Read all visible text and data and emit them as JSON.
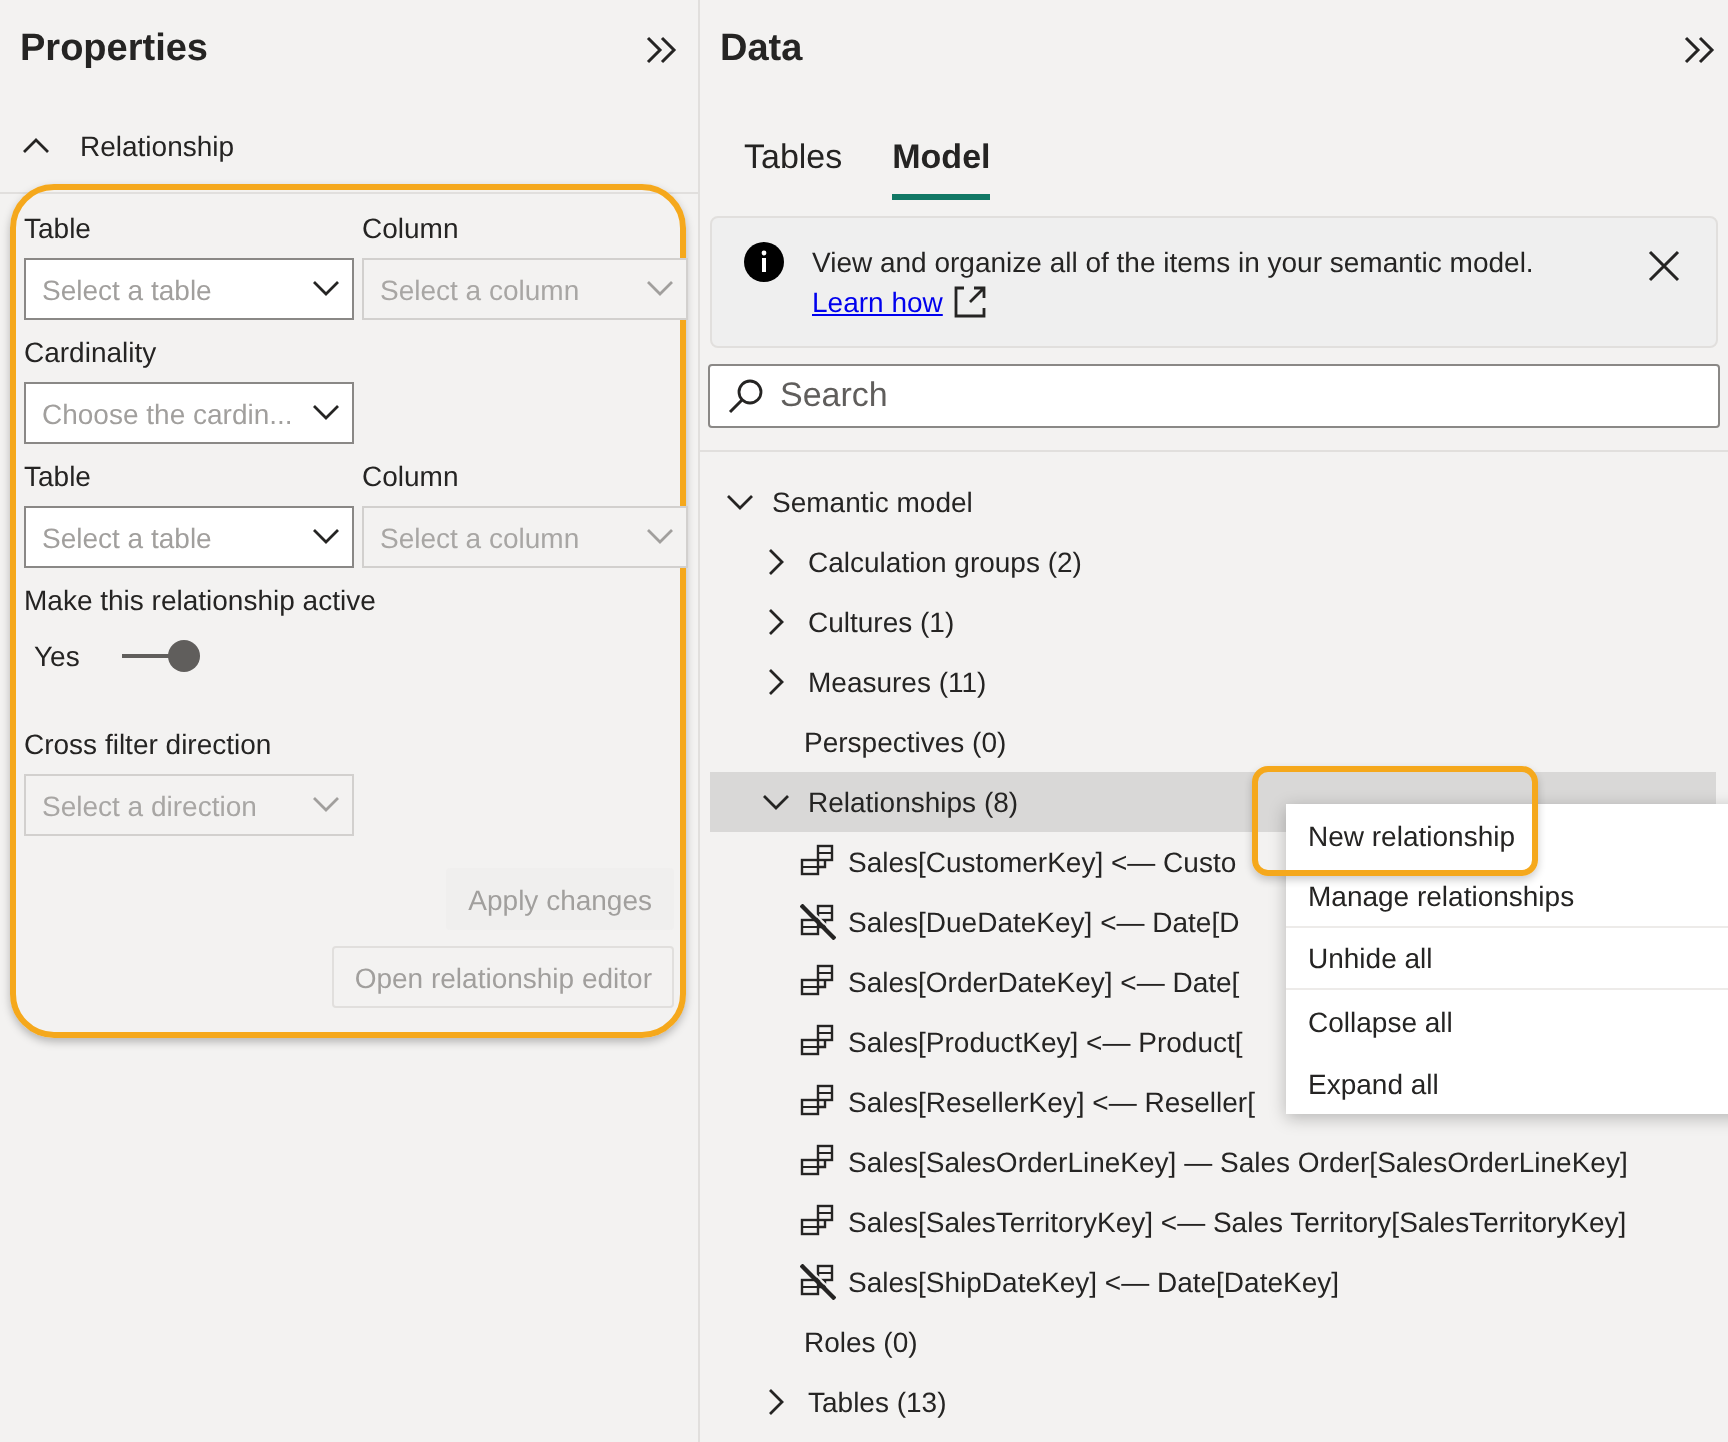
{
  "properties": {
    "title": "Properties",
    "section": {
      "title": "Relationship",
      "expanded": true
    },
    "highlighted": true,
    "rows": [
      {
        "fields": [
          {
            "label": "Table",
            "placeholder": "Select a table",
            "disabled": false
          },
          {
            "label": "Column",
            "placeholder": "Select a column",
            "disabled": true
          }
        ]
      },
      {
        "fields": [
          {
            "label": "Cardinality",
            "placeholder": "Choose the cardin...",
            "disabled": false
          }
        ]
      },
      {
        "fields": [
          {
            "label": "Table",
            "placeholder": "Select a table",
            "disabled": false
          },
          {
            "label": "Column",
            "placeholder": "Select a column",
            "disabled": true
          }
        ]
      }
    ],
    "toggle": {
      "label": "Make this relationship active",
      "value": "Yes",
      "on": true
    },
    "cross_filter": {
      "label": "Cross filter direction",
      "placeholder": "Select a direction",
      "disabled": true
    },
    "buttons": [
      {
        "label": "Apply changes",
        "kind": "plain",
        "disabled": true
      },
      {
        "label": "Open relationship editor",
        "kind": "outline",
        "disabled": true
      }
    ]
  },
  "data": {
    "title": "Data",
    "tabs": [
      {
        "label": "Tables",
        "selected": false
      },
      {
        "label": "Model",
        "selected": true
      }
    ],
    "info": {
      "text": "View and organize all of the items in your semantic model.",
      "link": "Learn how"
    },
    "search": {
      "placeholder": "Search"
    },
    "tree": {
      "label": "Semantic model",
      "expanded": true,
      "selected": false,
      "children": [
        {
          "label": "Calculation groups (2)",
          "expanded": false,
          "selected": false
        },
        {
          "label": "Cultures (1)",
          "expanded": false,
          "selected": false
        },
        {
          "label": "Measures (11)",
          "expanded": false,
          "selected": false
        },
        {
          "label": "Perspectives (0)",
          "selected": false
        },
        {
          "label": "Relationships (8)",
          "expanded": true,
          "selected": true,
          "children": [
            {
              "label": "Sales[CustomerKey] <— Custo",
              "active": true,
              "selected": false
            },
            {
              "label": "Sales[DueDateKey] <— Date[D",
              "active": false,
              "selected": false
            },
            {
              "label": "Sales[OrderDateKey] <— Date[",
              "active": true,
              "selected": false
            },
            {
              "label": "Sales[ProductKey] <— Product[",
              "active": true,
              "selected": false
            },
            {
              "label": "Sales[ResellerKey] <— Reseller[",
              "active": true,
              "selected": false
            },
            {
              "label": "Sales[SalesOrderLineKey] — Sales Order[SalesOrderLineKey]",
              "active": true,
              "selected": false
            },
            {
              "label": "Sales[SalesTerritoryKey] <— Sales Territory[SalesTerritoryKey]",
              "active": true,
              "selected": false
            },
            {
              "label": "Sales[ShipDateKey] <— Date[DateKey]",
              "active": false,
              "selected": false
            }
          ]
        },
        {
          "label": "Roles (0)",
          "selected": false
        },
        {
          "label": "Tables (13)",
          "expanded": false,
          "selected": false
        }
      ]
    },
    "context_menu": {
      "items": [
        {
          "label": "New relationship",
          "highlighted": true,
          "divider_after": false
        },
        {
          "label": "Manage relationships",
          "highlighted": false,
          "divider_after": true
        },
        {
          "label": "Unhide all",
          "highlighted": false,
          "divider_after": true
        },
        {
          "label": "Collapse all",
          "highlighted": false,
          "divider_after": false
        },
        {
          "label": "Expand all",
          "highlighted": false,
          "divider_after": false
        }
      ]
    }
  }
}
